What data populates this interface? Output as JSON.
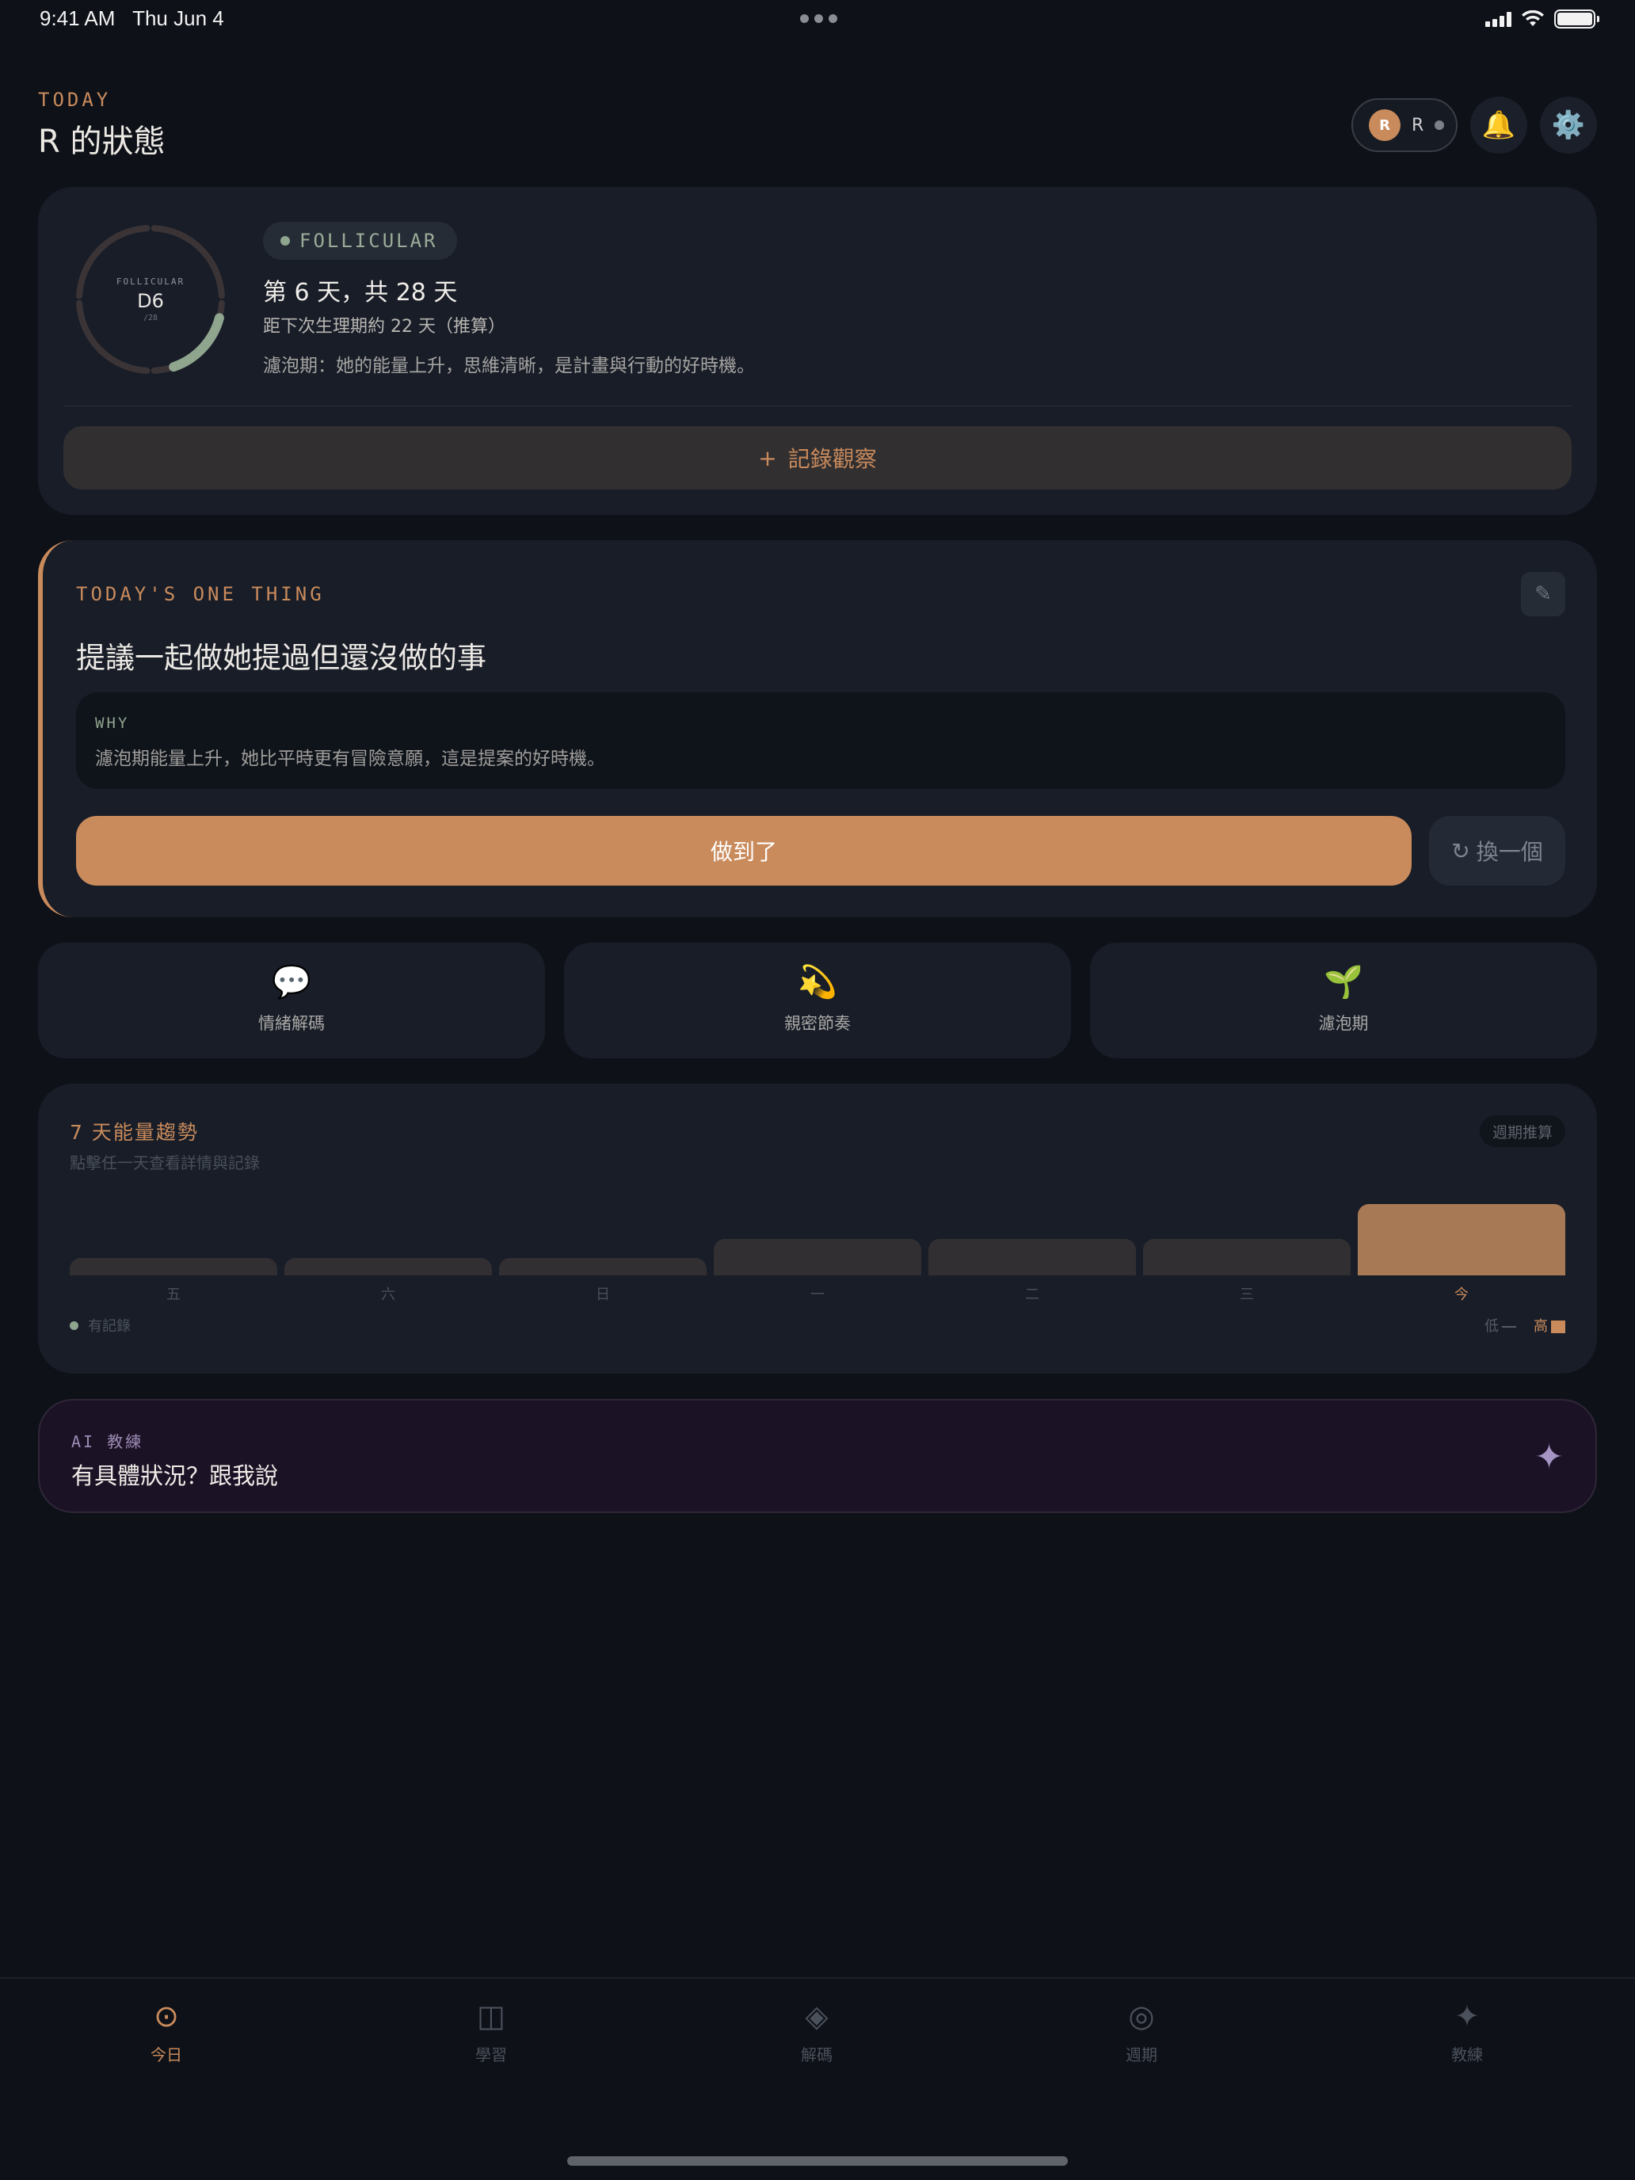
{
  "status_bar": {
    "time": "9:41 AM",
    "date": "Thu Jun 4"
  },
  "header": {
    "eyebrow": "TODAY",
    "title": "R 的狀態",
    "avatar_initial": "R",
    "profile_name": "R"
  },
  "cycle": {
    "ring_phase": "FOLLICULAR",
    "ring_day": "D6",
    "ring_total": "/28",
    "phase_pill": "FOLLICULAR",
    "day_line": "第 6 天，共 28 天",
    "next_line": "距下次生理期約 22 天（推算）",
    "description": "濾泡期：她的能量上升，思維清晰，是計畫與行動的好時機。",
    "log_label": "記錄觀察",
    "log_icon": "+",
    "progress_fraction": 0.214,
    "accent_color": "#8fa58e"
  },
  "one_thing": {
    "eyebrow": "TODAY'S ONE THING",
    "title": "提議一起做她提過但還沒做的事",
    "why_label": "WHY",
    "why_text": "濾泡期能量上升，她比平時更有冒險意願，這是提案的好時機。",
    "done_label": "做到了",
    "swap_label": "換一個",
    "swap_icon": "↻",
    "edit_icon": "✎"
  },
  "tiles": [
    {
      "icon": "💬",
      "label": "情緒解碼"
    },
    {
      "icon": "💫",
      "label": "親密節奏"
    },
    {
      "icon": "🌱",
      "label": "濾泡期"
    }
  ],
  "energy": {
    "title": "7 天能量趨勢",
    "subtitle": "點擊任一天查看詳情與記錄",
    "badge": "週期推算",
    "legend_recorded": "有記錄",
    "legend_low": "低",
    "legend_high": "高"
  },
  "chart_data": {
    "type": "bar",
    "categories": [
      "五",
      "六",
      "日",
      "一",
      "二",
      "三",
      "今"
    ],
    "values": [
      1,
      1,
      1,
      2,
      2,
      2,
      4
    ],
    "ylim": [
      0,
      4
    ],
    "highlight": "今",
    "colors": {
      "bar": "#312f32",
      "today": "#a87955"
    }
  },
  "ai_coach": {
    "eyebrow": "AI 教練",
    "text": "有具體狀況？跟我說",
    "icon": "✦"
  },
  "tabbar": [
    {
      "icon": "⊙",
      "label": "今日",
      "active": true
    },
    {
      "icon": "◫",
      "label": "學習",
      "active": false
    },
    {
      "icon": "◈",
      "label": "解碼",
      "active": false
    },
    {
      "icon": "◎",
      "label": "週期",
      "active": false
    },
    {
      "icon": "✦",
      "label": "教練",
      "active": false
    }
  ],
  "colors": {
    "accent": "#c98b5c",
    "background": "#0e1118",
    "card": "#181d28",
    "phase": "#8fa58e"
  }
}
